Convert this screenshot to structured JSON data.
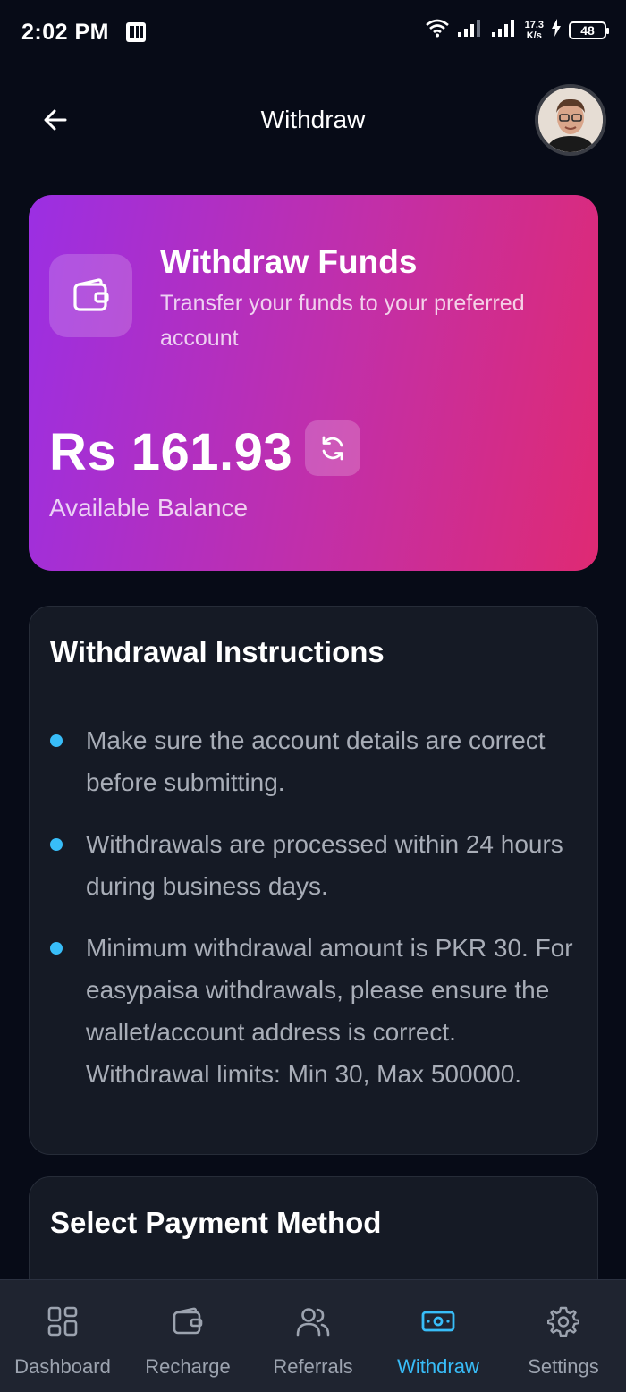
{
  "status_bar": {
    "time": "2:02 PM",
    "speed_value": "17.3",
    "speed_unit": "K/s",
    "battery": "48"
  },
  "header": {
    "title": "Withdraw",
    "back_icon": "arrow-left-icon"
  },
  "funds_card": {
    "title": "Withdraw Funds",
    "subtitle": "Transfer your funds to your preferred account",
    "balance": "Rs 161.93",
    "balance_label": "Available Balance",
    "gradient_start": "#9b2fe3",
    "gradient_end": "#df2a73"
  },
  "instructions": {
    "title": "Withdrawal Instructions",
    "items": [
      "Make sure the account details are correct before submitting.",
      "Withdrawals are processed within 24 hours during business days.",
      "Minimum withdrawal amount is PKR 30. For easypaisa withdrawals, please ensure the wallet/account address is correct. Withdrawal limits: Min 30, Max 500000."
    ],
    "bullet_color": "#38bdf8"
  },
  "payment": {
    "title": "Select Payment Method"
  },
  "nav": {
    "active": "withdraw",
    "active_color": "#38bdf8",
    "items": [
      {
        "label": "Dashboard",
        "icon": "grid-icon"
      },
      {
        "label": "Recharge",
        "icon": "wallet-icon"
      },
      {
        "label": "Referrals",
        "icon": "users-icon"
      },
      {
        "label": "Withdraw",
        "icon": "banknote-icon"
      },
      {
        "label": "Settings",
        "icon": "gear-icon"
      }
    ]
  }
}
